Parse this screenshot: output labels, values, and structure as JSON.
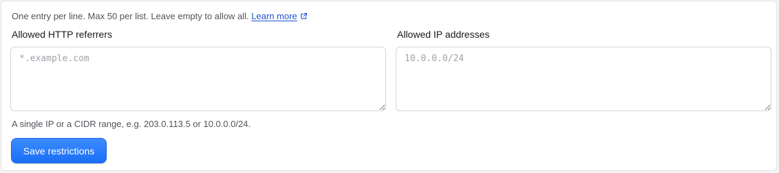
{
  "intro": {
    "text": "One entry per line. Max 50 per list. Leave empty to allow all.",
    "link_label": "Learn more",
    "link_icon": "external-link-icon"
  },
  "referrers": {
    "label": "Allowed HTTP referrers",
    "value": "",
    "placeholder": "*.example.com"
  },
  "ips": {
    "label": "Allowed IP addresses",
    "value": "",
    "placeholder": "10.0.0.0/24"
  },
  "help_text": "A single IP or a CIDR range, e.g. 203.0.113.5 or 10.0.0.0/24.",
  "save_button": {
    "label": "Save restrictions"
  },
  "colors": {
    "accent": "#2f80ff",
    "link": "#1d4ed8"
  }
}
